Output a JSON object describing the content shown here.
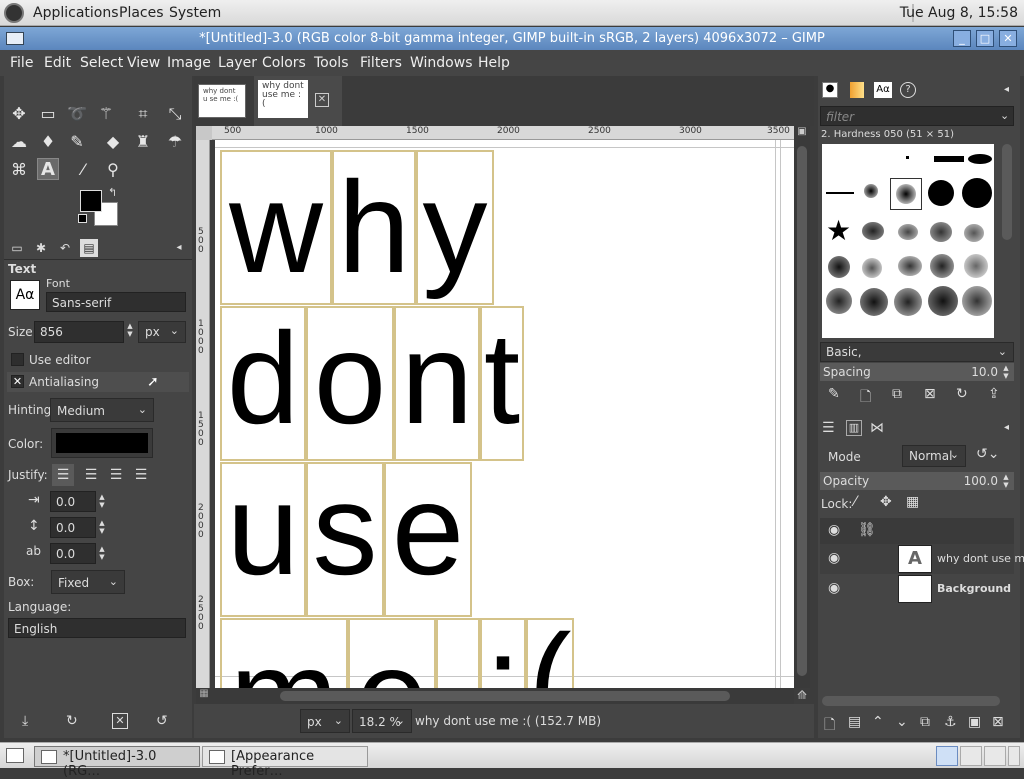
{
  "system_panel": {
    "menus": [
      "Applications",
      "Places",
      "System"
    ],
    "clock": "Tue Aug  8, 15:58"
  },
  "window": {
    "title": "*[Untitled]-3.0 (RGB color 8-bit gamma integer, GIMP built-in sRGB, 2 layers) 4096x3072 – GIMP"
  },
  "menubar": [
    "File",
    "Edit",
    "Select",
    "View",
    "Image",
    "Layer",
    "Colors",
    "Tools",
    "Filters",
    "Windows",
    "Help"
  ],
  "toolbox": {
    "tool_icons": [
      "move-icon",
      "rect-select-icon",
      "lasso-icon",
      "fuzzy-select-icon",
      "crop-icon",
      "transform-icon",
      "warp-icon",
      "bucket-fill-icon",
      "paintbrush-icon",
      "eraser-icon",
      "clone-icon",
      "smudge-icon",
      "paths-icon",
      "text-icon",
      "color-picker-icon",
      "zoom-icon"
    ],
    "fg_color": "#000000",
    "bg_color": "#ffffff"
  },
  "tool_options": {
    "section_title": "Text",
    "font_label": "Font",
    "font_preview": "Aα",
    "font_value": "Sans-serif",
    "size_label": "Size:",
    "size_value": "856",
    "size_unit": "px",
    "use_editor_label": "Use editor",
    "use_editor_checked": false,
    "antialiasing_label": "Antialiasing",
    "antialiasing_checked": true,
    "hinting_label": "Hinting:",
    "hinting_value": "Medium",
    "color_label": "Color:",
    "color_value": "#000000",
    "justify_label": "Justify:",
    "indent_value": "0.0",
    "line_spacing_value": "0.0",
    "letter_spacing_value": "0.0",
    "box_label": "Box:",
    "box_value": "Fixed",
    "language_label": "Language:",
    "language_value": "English"
  },
  "image_tabs": [
    {
      "thumb_text": "why dont u se me :("
    },
    {
      "thumb_text": "why dont use me :("
    }
  ],
  "rulers": {
    "h_ticks": [
      "500",
      "1000",
      "1500",
      "2000",
      "2500",
      "3000",
      "3500"
    ],
    "v_ticks": [
      "500",
      "1000",
      "1500",
      "2000",
      "2500"
    ]
  },
  "canvas_text": {
    "lines": [
      [
        "w",
        "h",
        "y"
      ],
      [
        "d",
        "o",
        "n",
        "t"
      ],
      [
        "u",
        "s",
        "e"
      ],
      [
        "m",
        "e",
        " ",
        ":",
        "("
      ]
    ]
  },
  "statusbar": {
    "unit": "px",
    "zoom": "18.2 %",
    "message": "why dont use me :( (152.7 MB)"
  },
  "brushes_panel": {
    "filter_placeholder": "filter",
    "brush_name": "2. Hardness 050 (51 × 51)",
    "tag_value": "Basic,",
    "spacing_label": "Spacing",
    "spacing_value": "10.0"
  },
  "layers_panel": {
    "mode_label": "Mode",
    "mode_value": "Normal",
    "opacity_label": "Opacity",
    "opacity_value": "100.0",
    "lock_label": "Lock:",
    "layers": [
      {
        "name": "why dont use me",
        "type": "text"
      },
      {
        "name": "Background",
        "type": "image"
      }
    ]
  },
  "taskbar": {
    "items": [
      "*[Untitled]-3.0 (RG…",
      "[Appearance Prefer…"
    ]
  }
}
